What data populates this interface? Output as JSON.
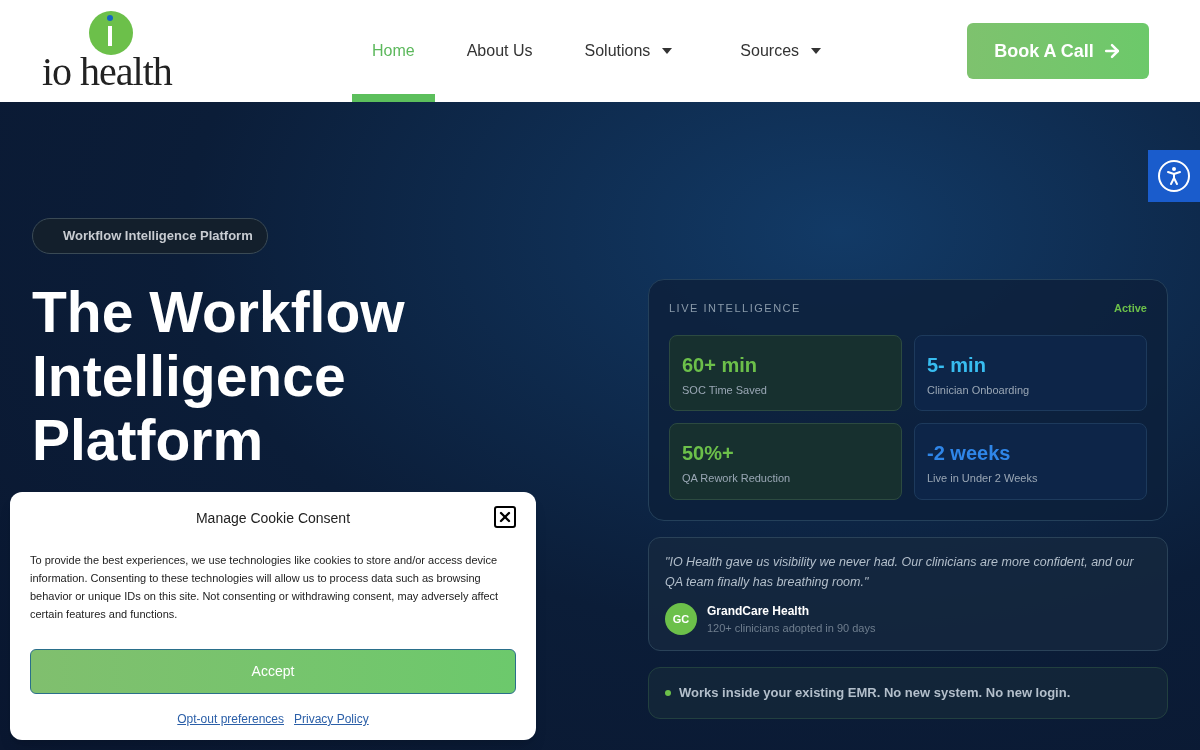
{
  "logo": {
    "wordmark": "io health"
  },
  "nav": [
    {
      "label": "Home",
      "selected": true,
      "has_menu": false
    },
    {
      "label": "About Us",
      "selected": false,
      "has_menu": false
    },
    {
      "label": "Solutions",
      "selected": false,
      "has_menu": true
    },
    {
      "label": "Sources",
      "selected": false,
      "has_menu": true
    }
  ],
  "cta": {
    "label": "Book A Call"
  },
  "hero": {
    "badge": "Workflow Intelligence Platform",
    "headline": [
      "The Workflow",
      "Intelligence",
      "Platform"
    ]
  },
  "panel": {
    "title": "LIVE INTELLIGENCE",
    "status": "Active",
    "metrics": [
      {
        "value": "60+ min",
        "label": "SOC Time Saved",
        "kind": "green"
      },
      {
        "value": "5- min",
        "label": "Clinician Onboarding",
        "kind": "cyan"
      },
      {
        "value": "50%+",
        "label": "QA Rework Reduction",
        "kind": "green"
      },
      {
        "value": "-2 weeks",
        "label": "Live in Under 2 Weeks",
        "kind": "blue"
      }
    ]
  },
  "testimonial": {
    "quote": "\"IO Health gave us visibility we never had. Our clinicians are more confident, and our QA team finally has breathing room.\"",
    "initials": "GC",
    "org": "GrandCare Health",
    "detail": "120+ clinicians adopted in 90 days"
  },
  "note": "Works inside your existing EMR. No new system. No new login.",
  "cookie": {
    "title": "Manage Cookie Consent",
    "body": "To provide the best experiences, we use technologies like cookies to store and/or access device information. Consenting to these technologies will allow us to process data such as browsing behavior or unique IDs on this site. Not consenting or withdrawing consent, may adversely affect certain features and functions.",
    "accept": "Accept",
    "links": [
      "Opt-out preferences",
      "Privacy Policy"
    ]
  }
}
